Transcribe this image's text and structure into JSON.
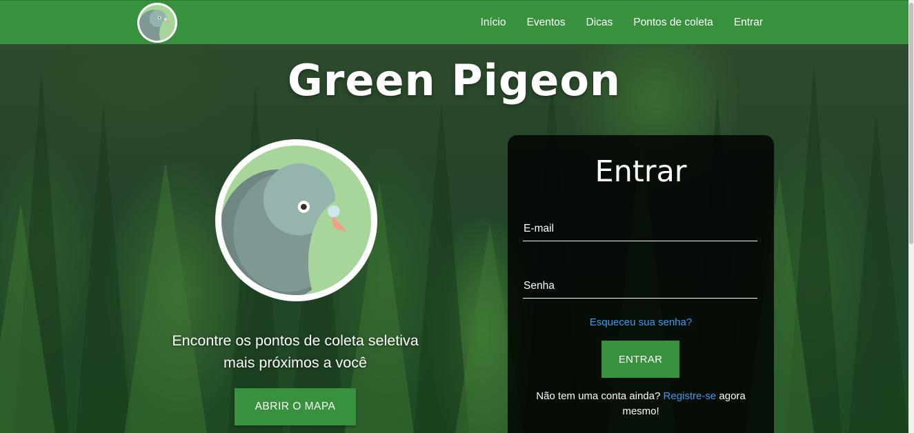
{
  "nav": {
    "links": [
      "Início",
      "Eventos",
      "Dicas",
      "Pontos de coleta",
      "Entrar"
    ]
  },
  "hero": {
    "title": "Green Pigeon",
    "tagline_line1": "Encontre os pontos de coleta seletiva",
    "tagline_line2": "mais próximos a você",
    "map_button": "ABRIR O MAPA"
  },
  "login": {
    "title": "Entrar",
    "email_placeholder": "E-mail",
    "password_placeholder": "Senha",
    "forgot": "Esqueceu sua senha?",
    "button": "ENTRAR",
    "register_prefix": "Não tem uma conta ainda?",
    "register_link": "Registre-se",
    "register_suffix": "agora mesmo!"
  },
  "colors": {
    "brand_green": "#38913d",
    "link_blue": "#3b9bf0",
    "panel_bg": "rgba(0,0,0,0.82)"
  },
  "icons": {
    "logo": "pigeon-logo-icon"
  }
}
